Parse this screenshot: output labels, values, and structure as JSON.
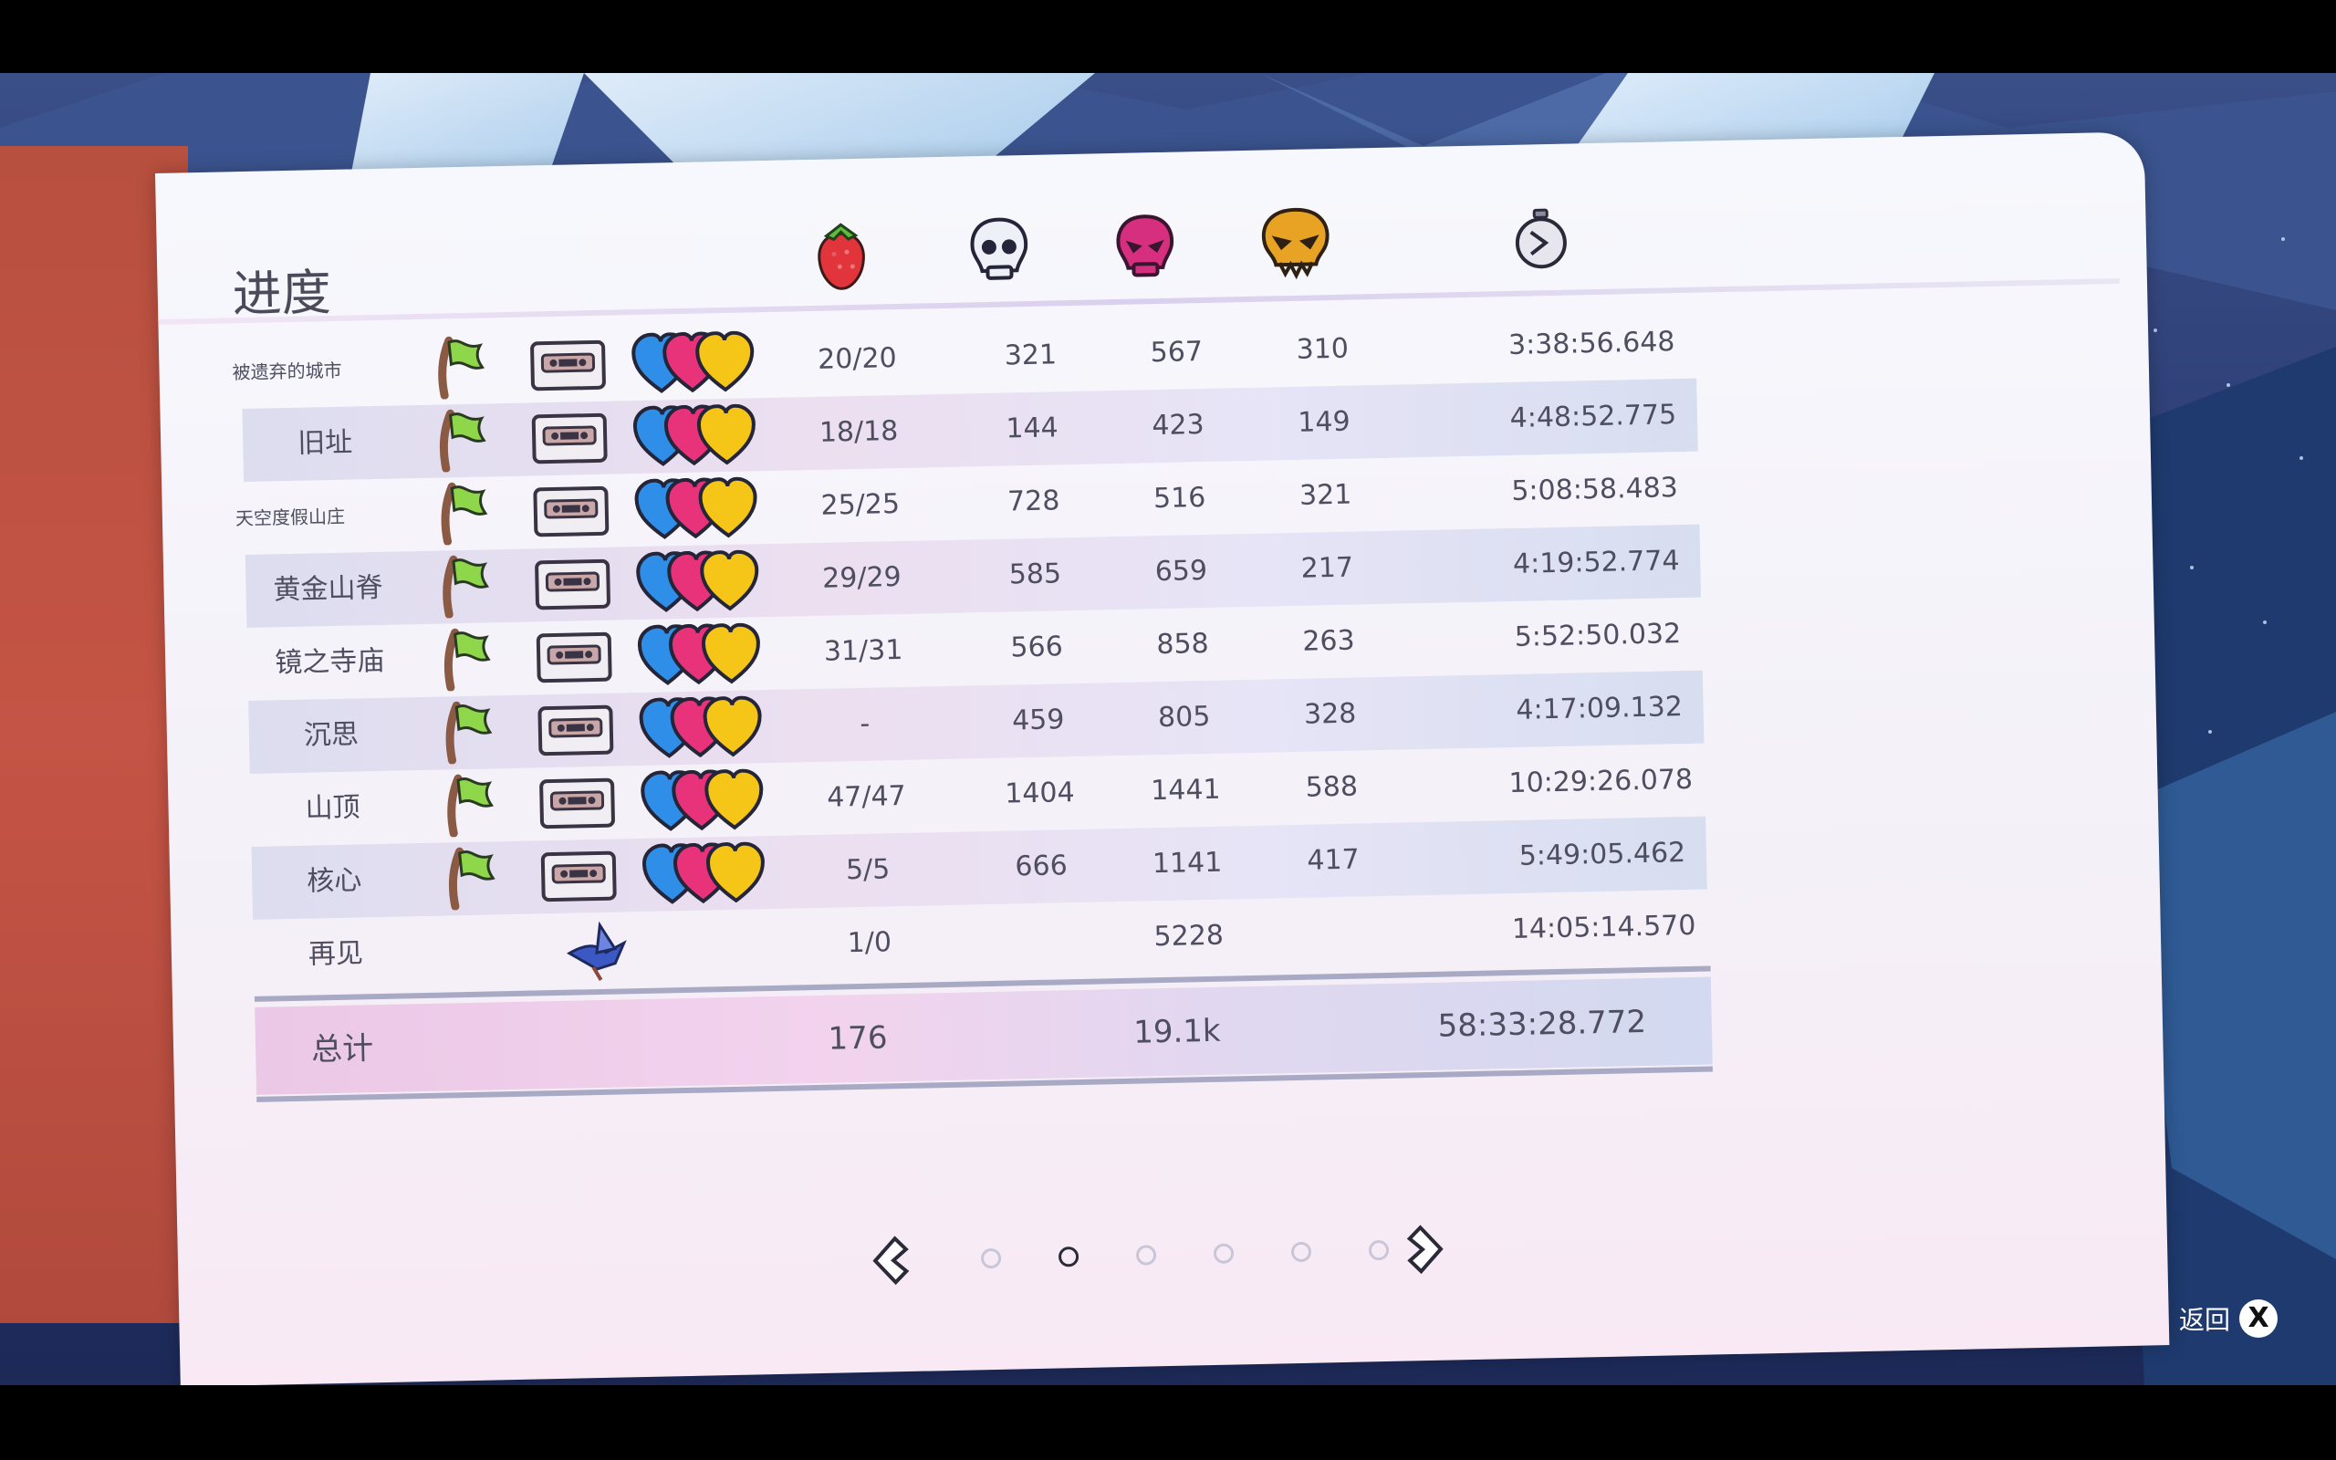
{
  "screen": {
    "title": "进度",
    "columns": {
      "strawberry_icon": "strawberry-icon",
      "deaths_icon": "skull-white-icon",
      "bside_deaths_icon": "skull-pink-icon",
      "cside_deaths_icon": "skull-gold-icon",
      "time_icon": "stopwatch-icon"
    },
    "rows": [
      {
        "name": "被遗弃的城市",
        "strawberries": "20/20",
        "deaths": "321",
        "deaths_b": "567",
        "deaths_c": "310",
        "time": "3:38:56.648",
        "small": true
      },
      {
        "name": "旧址",
        "strawberries": "18/18",
        "deaths": "144",
        "deaths_b": "423",
        "deaths_c": "149",
        "time": "4:48:52.775"
      },
      {
        "name": "天空度假山庄",
        "strawberries": "25/25",
        "deaths": "728",
        "deaths_b": "516",
        "deaths_c": "321",
        "time": "5:08:58.483",
        "small": true
      },
      {
        "name": "黄金山脊",
        "strawberries": "29/29",
        "deaths": "585",
        "deaths_b": "659",
        "deaths_c": "217",
        "time": "4:19:52.774"
      },
      {
        "name": "镜之寺庙",
        "strawberries": "31/31",
        "deaths": "566",
        "deaths_b": "858",
        "deaths_c": "263",
        "time": "5:52:50.032"
      },
      {
        "name": "沉思",
        "strawberries": "-",
        "deaths": "459",
        "deaths_b": "805",
        "deaths_c": "328",
        "time": "4:17:09.132"
      },
      {
        "name": "山顶",
        "strawberries": "47/47",
        "deaths": "1404",
        "deaths_b": "1441",
        "deaths_c": "588",
        "time": "10:29:26.078"
      },
      {
        "name": "核心",
        "strawberries": "5/5",
        "deaths": "666",
        "deaths_b": "1141",
        "deaths_c": "417",
        "time": "5:49:05.462"
      },
      {
        "name": "再见",
        "strawberries": "1/0",
        "deaths": "",
        "deaths_b": "5228",
        "deaths_c": "",
        "time": "14:05:14.570"
      }
    ],
    "total": {
      "label": "总计",
      "strawberries": "176",
      "deaths": "19.1k",
      "time": "58:33:28.772"
    },
    "pagination": {
      "pages": 6,
      "current": 2
    },
    "back_label": "返回",
    "back_button_glyph": "X"
  },
  "colors": {
    "heart_blue": "#2f8fe8",
    "heart_pink": "#e8337a",
    "heart_gold": "#f5c518",
    "flag_green": "#8ed64a",
    "flag_pole": "#8a5a44",
    "skull_pink": "#d62f7f",
    "skull_gold": "#e9a324"
  }
}
